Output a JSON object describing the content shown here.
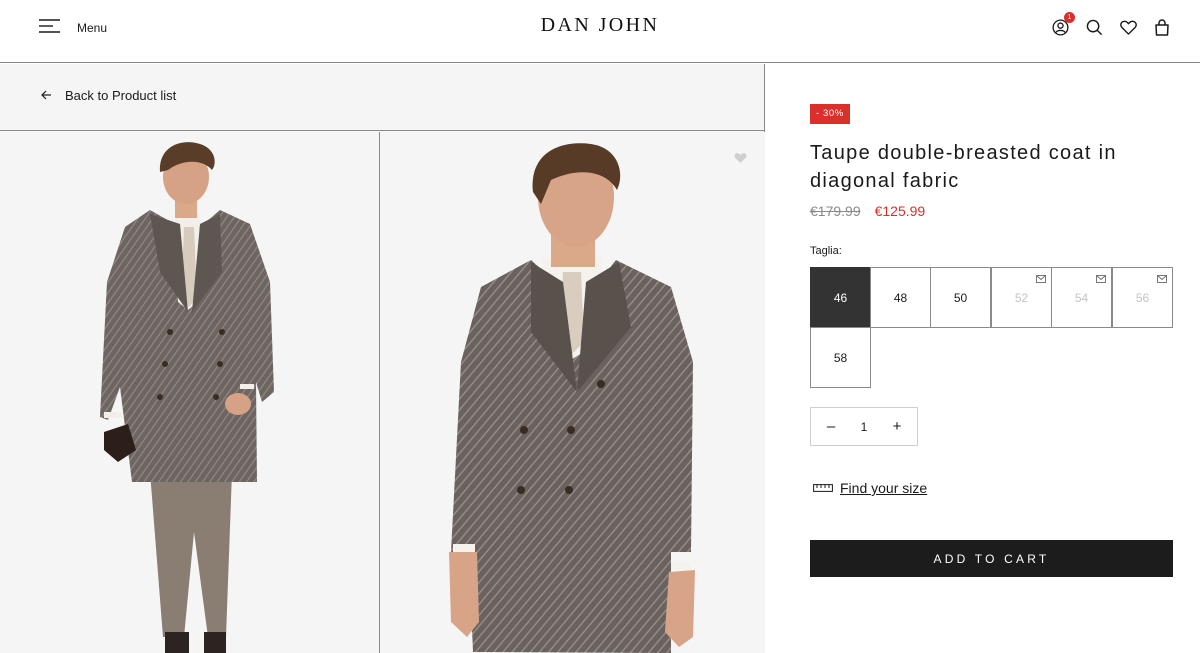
{
  "header": {
    "menu_label": "Menu",
    "logo": "DAN JOHN",
    "cart_badge_count": "1",
    "icons": [
      "hamburger-icon",
      "account-icon",
      "search-icon",
      "heart-icon",
      "bag-icon"
    ]
  },
  "nav": {
    "back_label": "Back to Product list"
  },
  "product": {
    "discount_badge": "- 30%",
    "title": "Taupe double-breasted coat in diagonal fabric",
    "old_price": "€179.99",
    "new_price": "€125.99",
    "size_label": "Taglia:",
    "sizes": [
      {
        "label": "46",
        "state": "selected"
      },
      {
        "label": "48",
        "state": "available"
      },
      {
        "label": "50",
        "state": "available"
      },
      {
        "label": "52",
        "state": "unavailable"
      },
      {
        "label": "54",
        "state": "unavailable"
      },
      {
        "label": "56",
        "state": "unavailable"
      },
      {
        "label": "58",
        "state": "available"
      }
    ],
    "quantity": "1",
    "find_size_label": "Find your size",
    "add_to_cart_label": "ADD TO CART"
  },
  "colors": {
    "accent_red": "#d9302c",
    "selected_size": "#333333",
    "cart_button": "#1c1c1c",
    "border": "#8a8a8a"
  }
}
